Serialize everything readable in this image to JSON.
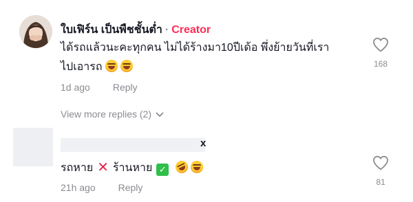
{
  "comments": [
    {
      "username": "ใบเฟิร์น เป็นพืชชั้นต่ำ",
      "dot": "·",
      "badge": "Creator",
      "text": "ได้รถแล้วนะคะทุกคน ไม่ได้ร้างมา10ปีเด้อ พึ่งย้ายวันที่เรา\nไปเอารถ",
      "time": "1d ago",
      "reply_label": "Reply",
      "likes": "168",
      "view_more": "View more replies (2)"
    },
    {
      "username_tail": "x",
      "text_part1": "รถหาย",
      "text_part2": "ร้านหาย",
      "time": "21h ago",
      "reply_label": "Reply",
      "likes": "81"
    }
  ],
  "icons": {
    "heart": "heart-outline-icon",
    "chevron": "chevron-down-icon",
    "laugh": "face-with-tears-of-joy-emoji",
    "rofl": "rolling-on-floor-laughing-emoji",
    "cross": "cross-mark-emoji",
    "check": "check-box-emoji"
  },
  "colors": {
    "creator_badge": "#fe2c55",
    "meta_text": "#8a8b91",
    "primary_text": "#161823",
    "cross": "#e3254c",
    "check": "#2fbf4a"
  }
}
